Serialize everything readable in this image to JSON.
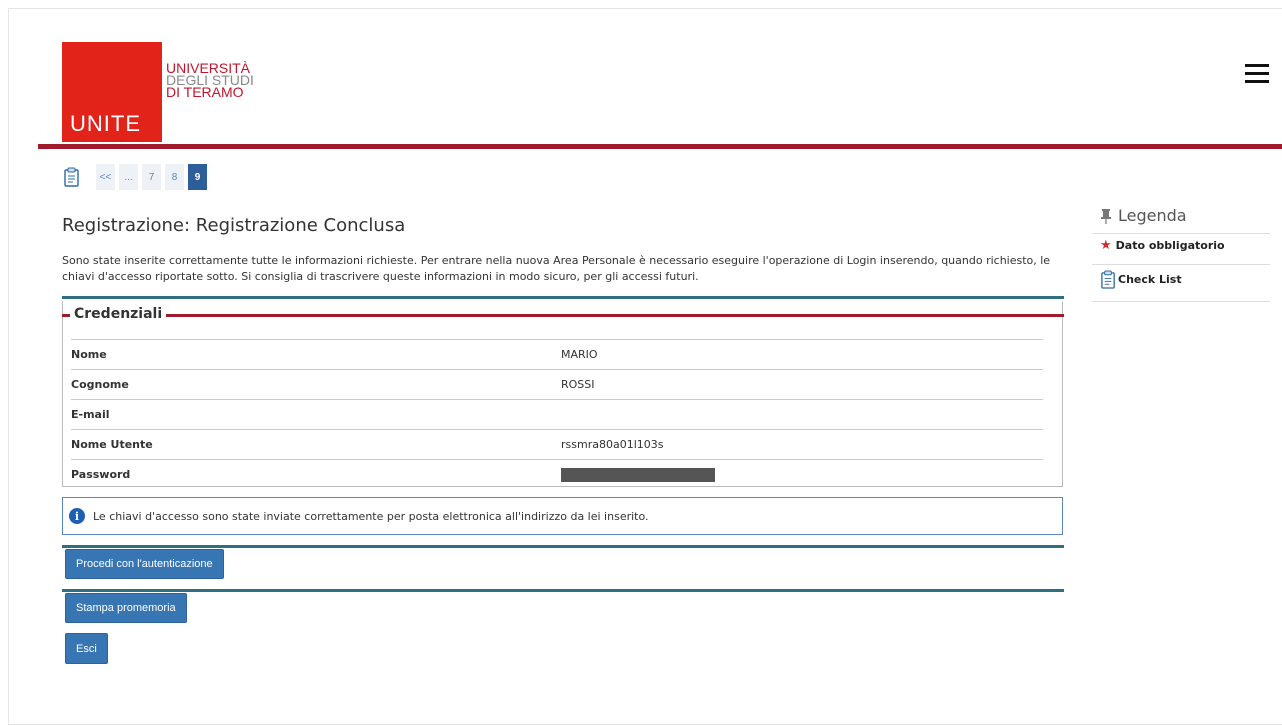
{
  "header": {
    "logo_short": "UNITE",
    "logo_line1": "UNIVERSITÀ",
    "logo_line2": "DEGLI STUDI",
    "logo_line3": "DI TERAMO"
  },
  "pager": {
    "items": [
      "<<",
      "...",
      "7",
      "8",
      "9"
    ],
    "active": "9"
  },
  "page": {
    "title": "Registrazione: Registrazione Conclusa",
    "intro": "Sono state inserite correttamente tutte le informazioni richieste. Per entrare nella nuova Area Personale è necessario eseguire l'operazione di Login inserendo, quando richiesto, le chiavi d'accesso riportate sotto. Si consiglia di trascrivere queste informazioni in modo sicuro, per gli accessi futuri."
  },
  "credentials": {
    "legend": "Credenziali",
    "rows": [
      {
        "label": "Nome",
        "value": "MARIO"
      },
      {
        "label": "Cognome",
        "value": "ROSSI"
      },
      {
        "label": "E-mail",
        "value": ""
      },
      {
        "label": "Nome Utente",
        "value": "rssmra80a01l103s"
      },
      {
        "label": "Password",
        "value": ""
      }
    ]
  },
  "info_message": "Le chiavi d'accesso sono state inviate correttamente per posta elettronica all'indirizzo da lei inserito.",
  "buttons": {
    "proceed": "Procedi con l'autenticazione",
    "print": "Stampa promemoria",
    "exit": "Esci"
  },
  "sidebar": {
    "title": "Legenda",
    "required": "Dato obbligatorio",
    "checklist": "Check List"
  },
  "colors": {
    "brand_red": "#e2231a",
    "accent_bar": "#a01c2c",
    "teal_rule": "#2f6f84",
    "button_blue": "#3776b3"
  },
  "icons": [
    "checklist-icon",
    "info-icon",
    "pin-icon",
    "required-star-icon",
    "menu-icon"
  ]
}
